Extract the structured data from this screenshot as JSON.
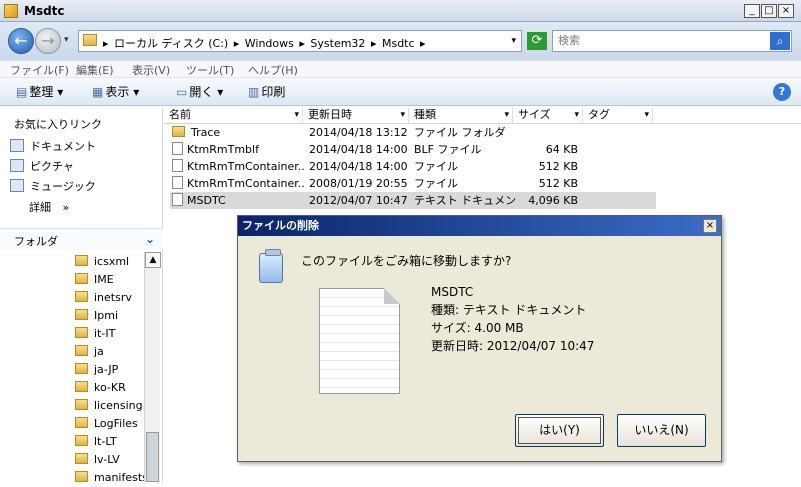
{
  "window": {
    "title": "Msdtc",
    "min": "_",
    "max": "□",
    "close": "×"
  },
  "address": {
    "path": [
      "ローカル ディスク (C:)",
      "Windows",
      "System32",
      "Msdtc"
    ],
    "sep": "▸",
    "dropdown": "▾",
    "search_placeholder": "検索"
  },
  "menu": [
    "ファイル(F)",
    "編集(E)",
    "表示(V)",
    "ツール(T)",
    "ヘルプ(H)"
  ],
  "toolbar": {
    "organize": "整理",
    "view": "表示",
    "open": "開く",
    "print": "印刷",
    "drop": "▾",
    "help": "?"
  },
  "sidebar": {
    "favorites_label": "お気に入りリンク",
    "favorites": [
      "ドキュメント",
      "ピクチャ",
      "ミュージック"
    ],
    "more": "詳細",
    "more_arrow": "»",
    "folders_label": "フォルダ",
    "folders_toggle": "⌄",
    "tree": [
      "icsxml",
      "IME",
      "inetsrv",
      "Ipmi",
      "it-IT",
      "ja",
      "ja-JP",
      "ko-KR",
      "licensing",
      "LogFiles",
      "lt-LT",
      "lv-LV",
      "manifests"
    ]
  },
  "list": {
    "columns": [
      "名前",
      "更新日時",
      "種類",
      "サイズ",
      "タグ"
    ],
    "sort_indicator": "▾",
    "rows": [
      {
        "name": "Trace",
        "date": "2014/04/18 13:12",
        "type": "ファイル フォルダ",
        "size": ""
      },
      {
        "name": "KtmRmTmblf",
        "date": "2014/04/18 14:00",
        "type": "BLF ファイル",
        "size": "64 KB"
      },
      {
        "name": "KtmRmTmContainer...",
        "date": "2014/04/18 14:00",
        "type": "ファイル",
        "size": "512 KB"
      },
      {
        "name": "KtmRmTmContainer...",
        "date": "2008/01/19 20:55",
        "type": "ファイル",
        "size": "512 KB"
      },
      {
        "name": "MSDTC",
        "date": "2012/04/07 10:47",
        "type": "テキスト ドキュメント",
        "size": "4,096 KB"
      }
    ]
  },
  "dialog": {
    "title": "ファイルの削除",
    "close": "×",
    "question": "このファイルをごみ箱に移動しますか?",
    "file_name": "MSDTC",
    "type_line": "種類: テキスト ドキュメント",
    "size_line": "サイズ: 4.00 MB",
    "date_line": "更新日時: 2012/04/07 10:47",
    "yes": "はい(Y)",
    "no": "いいえ(N)"
  }
}
